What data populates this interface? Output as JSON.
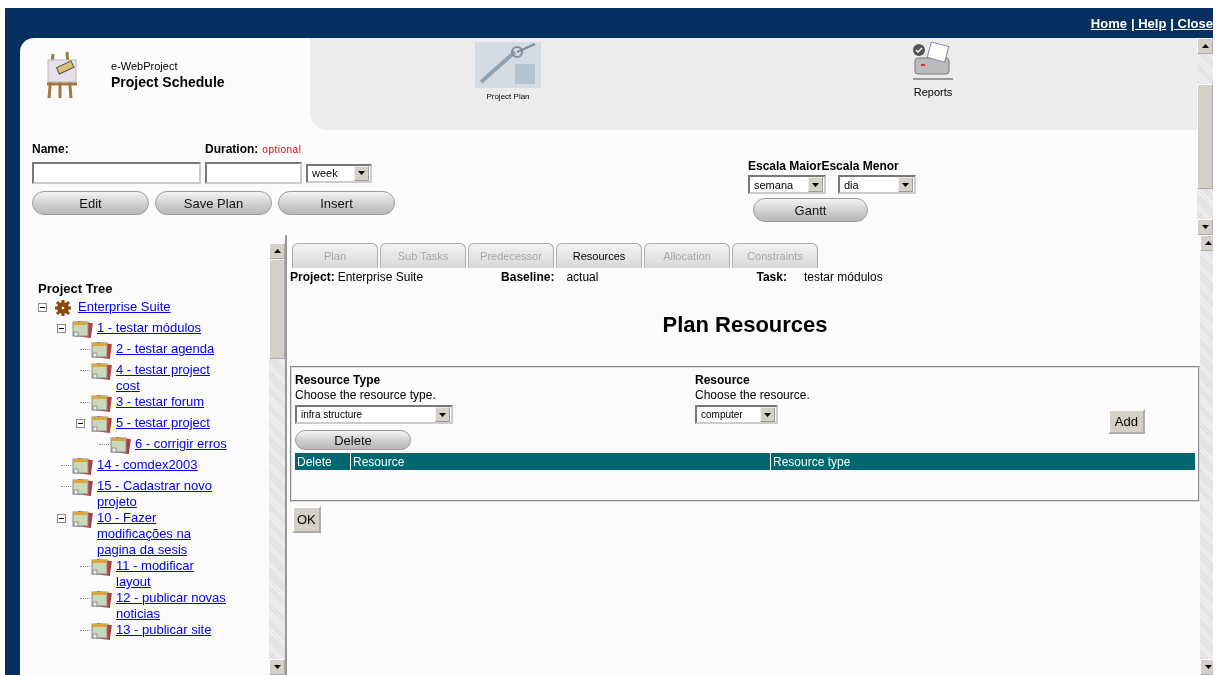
{
  "top_links": [
    "Home",
    "| Help",
    "| Close"
  ],
  "app": {
    "name": "e-WebProject",
    "title": "Project Schedule"
  },
  "toolbar": [
    {
      "label": "Project Plan",
      "kind": "plan"
    },
    {
      "label": "Reports",
      "kind": "reports"
    }
  ],
  "form": {
    "name_label": "Name:",
    "duration_label": "Duration:",
    "duration_note": "optional",
    "unit_value": "week",
    "buttons": [
      "Edit",
      "Save Plan",
      "Insert"
    ]
  },
  "scale": {
    "major_label": "Escala Maior",
    "minor_label": "Escala Menor",
    "major_value": "semana",
    "minor_value": "dia",
    "button": "Gantt"
  },
  "tree": {
    "title": "Project Tree",
    "items": [
      {
        "label": "Enterprise Suite",
        "kind": "project",
        "expanded": true,
        "children": [
          {
            "label": "1 - testar módulos",
            "kind": "task",
            "expanded": true,
            "children": [
              {
                "label": "2 - testar agenda",
                "kind": "task"
              },
              {
                "label": "4 - testar project cost",
                "kind": "task"
              },
              {
                "label": "3 - testar forum",
                "kind": "task"
              },
              {
                "label": "5 - testar project",
                "kind": "task",
                "expanded": true,
                "children": [
                  {
                    "label": "6 - corrigir erros",
                    "kind": "task"
                  }
                ]
              }
            ]
          },
          {
            "label": "14 - comdex2003",
            "kind": "task"
          },
          {
            "label": "15 - Cadastrar novo projeto",
            "kind": "task"
          },
          {
            "label": "10 - Fazer modificações na pagina da sesis",
            "kind": "task",
            "expanded": true,
            "children": [
              {
                "label": "11 - modificar layout",
                "kind": "task"
              },
              {
                "label": "12 - publicar novas noticias",
                "kind": "task"
              },
              {
                "label": "13 - publicar site",
                "kind": "task"
              }
            ]
          }
        ]
      }
    ]
  },
  "tabs": [
    {
      "label": "Plan",
      "selected": false
    },
    {
      "label": "Sub Tasks",
      "selected": false
    },
    {
      "label": "Predecessor",
      "selected": false
    },
    {
      "label": "Resources",
      "selected": true
    },
    {
      "label": "Allocation",
      "selected": false
    },
    {
      "label": "Constraints",
      "selected": false
    }
  ],
  "info": [
    {
      "label": "Project:",
      "value": "Enterprise Suite"
    },
    {
      "label": "Baseline:",
      "value": "actual"
    },
    {
      "label": "Task:",
      "value": "testar módulos"
    }
  ],
  "heading": "Plan Resources",
  "resource_form": {
    "type_label": "Resource Type",
    "type_hint": "Choose the resource type.",
    "type_value": "infra structure",
    "resource_label": "Resource",
    "resource_hint": "Choose the resource.",
    "resource_value": "computer",
    "add_button": "Add",
    "delete_button": "Delete"
  },
  "table": {
    "columns": [
      "Delete",
      "Resource",
      "Resource type"
    ]
  },
  "ok_button": "OK"
}
